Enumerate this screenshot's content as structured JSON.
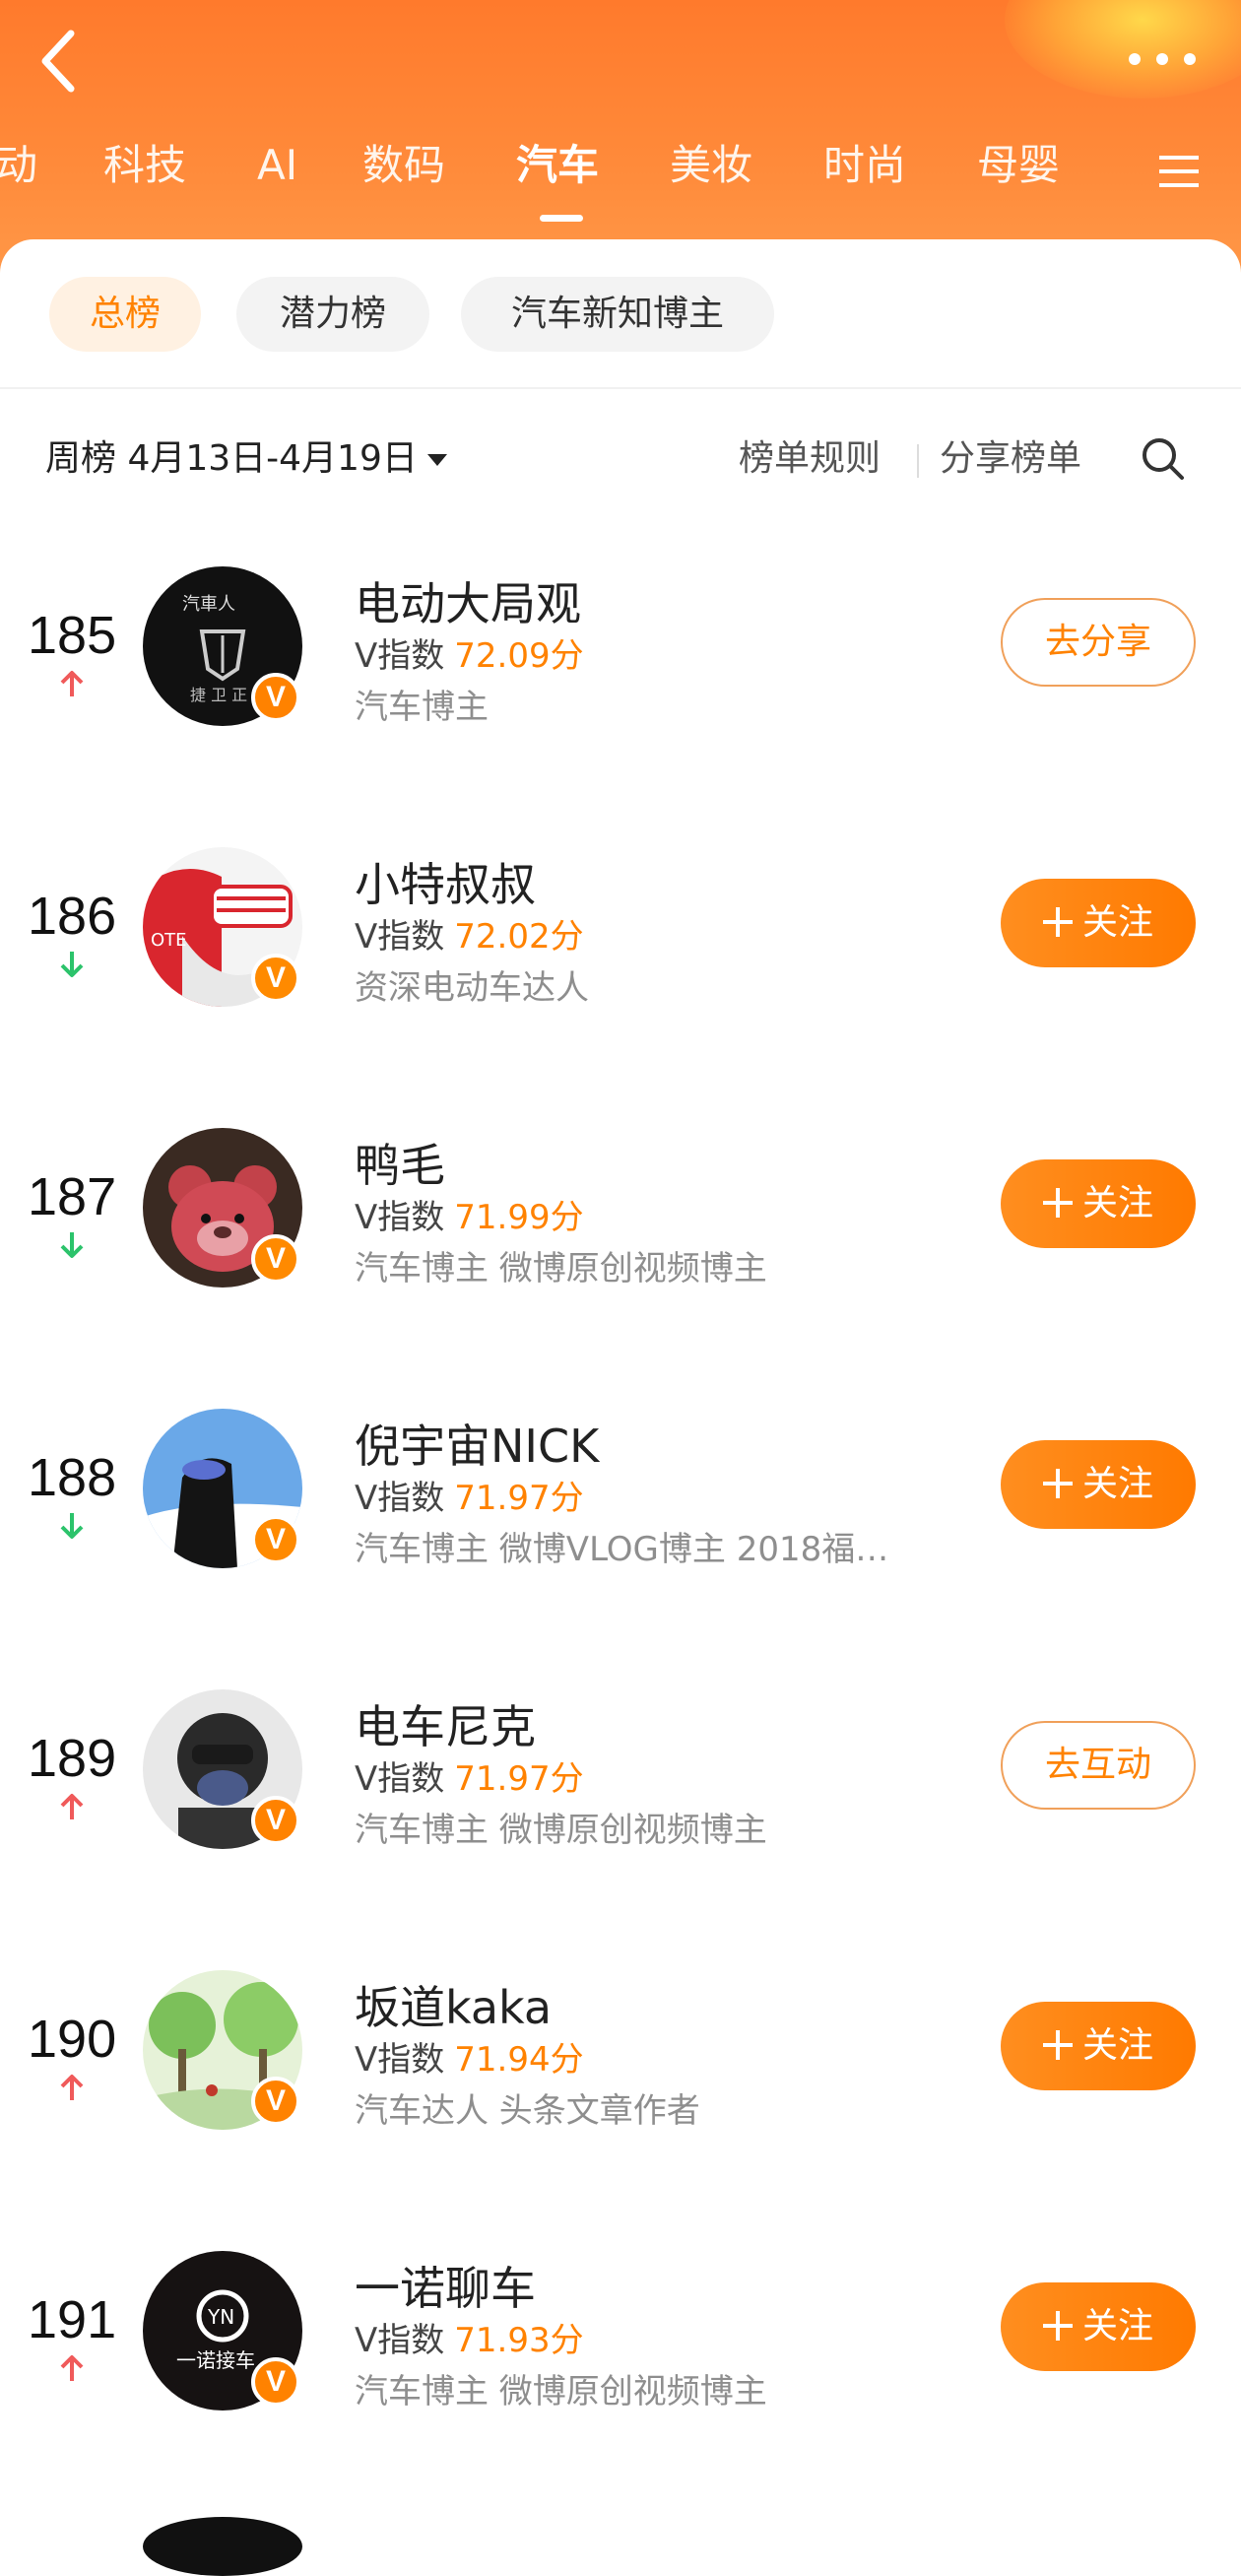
{
  "colors": {
    "accent": "#ff8200",
    "header": "#ff7a2c",
    "up": "#f05a5a",
    "down": "#2cc36b"
  },
  "header": {
    "back_icon": "chevron-left-icon",
    "more_icon": "more-dots-icon",
    "menu_icon": "menu-icon",
    "tabs": [
      {
        "label": "动"
      },
      {
        "label": "科技"
      },
      {
        "label": "AI"
      },
      {
        "label": "数码"
      },
      {
        "label": "汽车",
        "active": true
      },
      {
        "label": "美妆"
      },
      {
        "label": "时尚"
      },
      {
        "label": "母婴"
      }
    ]
  },
  "chips": [
    {
      "label": "总榜",
      "active": true
    },
    {
      "label": "潜力榜"
    },
    {
      "label": "汽车新知博主"
    }
  ],
  "period": {
    "label": "周榜 4月13日-4月19日"
  },
  "links": {
    "rules": "榜单规则",
    "share": "分享榜单",
    "search_icon": "search-icon"
  },
  "entries": [
    {
      "rank": "185",
      "trend": "up",
      "name": "电动大局观",
      "v_label": "V指数",
      "score": "72.09分",
      "desc": "汽车博主",
      "action": "去分享",
      "action_style": "outline"
    },
    {
      "rank": "186",
      "trend": "down",
      "name": "小特叔叔",
      "v_label": "V指数",
      "score": "72.02分",
      "desc": "资深电动车达人",
      "action": "关注",
      "action_style": "follow"
    },
    {
      "rank": "187",
      "trend": "down",
      "name": "鸭毛",
      "v_label": "V指数",
      "score": "71.99分",
      "desc": "汽车博主 微博原创视频博主",
      "action": "关注",
      "action_style": "follow"
    },
    {
      "rank": "188",
      "trend": "down",
      "name": "倪宇宙NICK",
      "v_label": "V指数",
      "score": "71.97分",
      "desc": "汽车博主 微博VLOG博主 2018福…",
      "action": "关注",
      "action_style": "follow"
    },
    {
      "rank": "189",
      "trend": "up",
      "name": "电车尼克",
      "v_label": "V指数",
      "score": "71.97分",
      "desc": "汽车博主 微博原创视频博主",
      "action": "去互动",
      "action_style": "outline"
    },
    {
      "rank": "190",
      "trend": "up",
      "name": "坂道kaka",
      "v_label": "V指数",
      "score": "71.94分",
      "desc": "汽车达人 头条文章作者",
      "action": "关注",
      "action_style": "follow"
    },
    {
      "rank": "191",
      "trend": "up",
      "name": "一诺聊车",
      "v_label": "V指数",
      "score": "71.93分",
      "desc": "汽车博主 微博原创视频博主",
      "action": "关注",
      "action_style": "follow"
    }
  ],
  "badge_letter": "V"
}
